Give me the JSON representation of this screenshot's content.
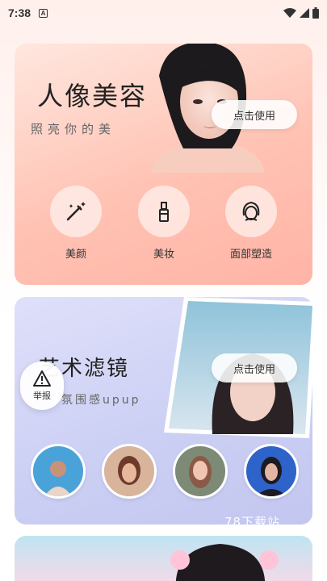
{
  "status_bar": {
    "time": "7:38",
    "a_icon": "A"
  },
  "card1": {
    "title": "人像美容",
    "subtitle": "照亮你的美",
    "use_button": "点击使用",
    "features": [
      {
        "label": "美颜",
        "icon": "magic-wand-icon"
      },
      {
        "label": "美妆",
        "icon": "lipstick-icon"
      },
      {
        "label": "面部塑造",
        "icon": "face-contour-icon"
      }
    ]
  },
  "card2": {
    "title": "艺术滤镜",
    "subtitle": "氛围感upup",
    "use_button": "点击使用"
  },
  "report": {
    "label": "举报"
  },
  "watermark": "78下载站",
  "colors": {
    "card1": "#ffc2b3",
    "card2": "#ccd0f4",
    "card3": "#bfe4f2"
  }
}
